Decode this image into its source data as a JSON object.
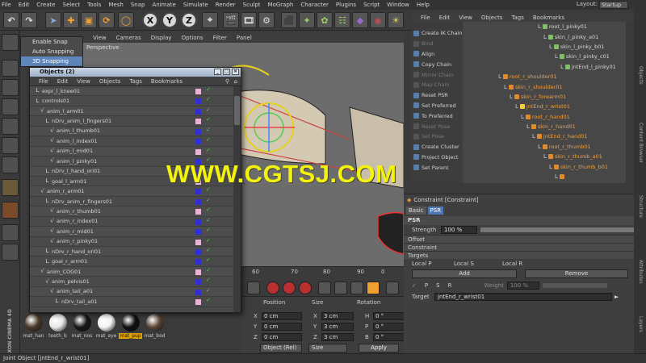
{
  "menubar": {
    "items": [
      "File",
      "Edit",
      "Create",
      "Select",
      "Tools",
      "Mesh",
      "Snap",
      "Animate",
      "Simulate",
      "Render",
      "Sculpt",
      "MoGraph",
      "Character",
      "Plugins",
      "Script",
      "Window",
      "Help"
    ],
    "layout_label": "Layout:",
    "layout_value": "Startup"
  },
  "toolbar": {
    "buttons": [
      "undo-icon",
      "redo-icon",
      "live-select-icon",
      "move-icon",
      "scale-icon",
      "rotate-icon",
      "recent-icon"
    ],
    "axis_x": "X",
    "axis_y": "Y",
    "axis_z": "Z"
  },
  "snap_menu": {
    "items": [
      "Enable Snap",
      "Auto Snapping",
      "3D Snapping"
    ],
    "selected_index": 2
  },
  "viewport": {
    "menu": [
      "View",
      "Cameras",
      "Display",
      "Options",
      "Filter",
      "Panel"
    ],
    "label": "Perspective"
  },
  "objects_window": {
    "title": "Objects (2)",
    "menu": [
      "File",
      "Edit",
      "View",
      "Objects",
      "Tags",
      "Bookmarks"
    ],
    "rows": [
      {
        "name": "expr_l_knee01",
        "indent": 0
      },
      {
        "name": "controls01",
        "indent": 0
      },
      {
        "name": "anim_l_arm01",
        "indent": 1
      },
      {
        "name": "nDrv_anim_l_fingers01",
        "indent": 2
      },
      {
        "name": "anim_l_thumb01",
        "indent": 3
      },
      {
        "name": "anim_l_index01",
        "indent": 3
      },
      {
        "name": "anim_l_mid01",
        "indent": 3
      },
      {
        "name": "anim_l_pinky01",
        "indent": 3
      },
      {
        "name": "nDrv_l_hand_ori01",
        "indent": 2
      },
      {
        "name": "goal_l_arm01",
        "indent": 2
      },
      {
        "name": "anim_r_arm01",
        "indent": 1
      },
      {
        "name": "nDrv_anim_r_fingers01",
        "indent": 2
      },
      {
        "name": "anim_r_thumb01",
        "indent": 3
      },
      {
        "name": "anim_r_index01",
        "indent": 3
      },
      {
        "name": "anim_r_mid01",
        "indent": 3
      },
      {
        "name": "anim_r_pinky01",
        "indent": 3
      },
      {
        "name": "nDrv_r_hand_ori01",
        "indent": 2
      },
      {
        "name": "goal_r_arm01",
        "indent": 2
      },
      {
        "name": "anim_COG01",
        "indent": 1
      },
      {
        "name": "anim_pelvis01",
        "indent": 2
      },
      {
        "name": "anim_tail_a01",
        "indent": 3
      },
      {
        "name": "nDrv_tail_a01",
        "indent": 4
      }
    ]
  },
  "command_panel": {
    "items": [
      {
        "label": "Create IK Chain",
        "enabled": true
      },
      {
        "label": "Bind",
        "enabled": false
      },
      {
        "label": "Align",
        "enabled": true
      },
      {
        "label": "Copy Chain",
        "enabled": true
      },
      {
        "label": "Mirror Chain",
        "enabled": false
      },
      {
        "label": "Map Chain",
        "enabled": false
      },
      {
        "label": "Reset PSR",
        "enabled": true
      },
      {
        "label": "Set Preferred",
        "enabled": true
      },
      {
        "label": "To Preferred",
        "enabled": true
      },
      {
        "label": "Reset Pose",
        "enabled": false
      },
      {
        "label": "Set Pose",
        "enabled": false
      },
      {
        "label": "Create Cluster",
        "enabled": true
      },
      {
        "label": "Project Object",
        "enabled": true
      },
      {
        "label": "Set Parent",
        "enabled": true
      }
    ]
  },
  "object_manager": {
    "menu": [
      "File",
      "Edit",
      "View",
      "Objects",
      "Tags",
      "Bookmarks"
    ],
    "rows": [
      {
        "name": "root_l_pinky01",
        "indent": 7,
        "color": "#7fbf6a",
        "selected": false
      },
      {
        "name": "skin_l_pinky_a01",
        "indent": 8,
        "color": "#7fbf6a",
        "selected": false
      },
      {
        "name": "skin_l_pinky_b01",
        "indent": 9,
        "color": "#7fbf6a",
        "selected": false
      },
      {
        "name": "skin_l_pinky_c01",
        "indent": 10,
        "color": "#7fbf6a",
        "selected": false
      },
      {
        "name": "jntEnd_l_pinky01",
        "indent": 11,
        "color": "#7fbf6a",
        "selected": false
      },
      {
        "name": "root_r_shoulder01",
        "indent": 0,
        "color": "#e08a2a",
        "selected": true
      },
      {
        "name": "skin_r_shoulder01",
        "indent": 1,
        "color": "#e08a2a",
        "selected": true
      },
      {
        "name": "skin_r_forearm01",
        "indent": 2,
        "color": "#e08a2a",
        "selected": true
      },
      {
        "name": "jntEnd_r_wrist01",
        "indent": 3,
        "color": "#f0d040",
        "selected": true
      },
      {
        "name": "root_r_hand01",
        "indent": 4,
        "color": "#e08a2a",
        "selected": true
      },
      {
        "name": "skin_r_hand01",
        "indent": 5,
        "color": "#e08a2a",
        "selected": true
      },
      {
        "name": "jntEnd_r_hand01",
        "indent": 6,
        "color": "#e08a2a",
        "selected": true
      },
      {
        "name": "root_r_thumb01",
        "indent": 7,
        "color": "#e08a2a",
        "selected": true
      },
      {
        "name": "skin_r_thumb_a01",
        "indent": 8,
        "color": "#e08a2a",
        "selected": true
      },
      {
        "name": "skin_r_thumb_b01",
        "indent": 9,
        "color": "#e08a2a",
        "selected": true
      },
      {
        "name": "",
        "indent": 10,
        "color": "#e08a2a",
        "selected": true
      }
    ]
  },
  "side_tabs": [
    "Objects",
    "Content Browser",
    "Structure",
    "Attributes",
    "Layers"
  ],
  "attributes": {
    "header": "Constraint [Constraint]",
    "tabs": [
      "Basic",
      "PSR"
    ],
    "selected_tab": 1,
    "section": "PSR",
    "strength_label": "Strength",
    "strength_value": "100 %",
    "strength_fraction": 1.0,
    "groups": [
      "Offset",
      "Constraint",
      "Targets"
    ],
    "radio_labels": [
      "Local P",
      "Local S",
      "Local R"
    ],
    "add_label": "Add",
    "remove_label": "Remove",
    "target_letter_p": "P",
    "target_letter_s": "S",
    "target_letter_r": "R",
    "weight_label": "Weight",
    "weight_value": "100 %",
    "target_label": "Target",
    "target_value": "jntEnd_r_wrist01"
  },
  "timeline": {
    "ticks": [
      "60",
      "70",
      "80",
      "90"
    ],
    "frame_label": "0"
  },
  "coordinates": {
    "headers": [
      "Position",
      "Size",
      "Rotation"
    ],
    "rows": [
      {
        "axis": "X",
        "pos": "0 cm",
        "size_axis": "X",
        "size": "3 cm",
        "rot_axis": "H",
        "rot": "0 °"
      },
      {
        "axis": "Y",
        "pos": "0 cm",
        "size_axis": "Y",
        "size": "3 cm",
        "rot_axis": "P",
        "rot": "0 °"
      },
      {
        "axis": "Z",
        "pos": "0 cm",
        "size_axis": "Z",
        "size": "3 cm",
        "rot_axis": "B",
        "rot": "0 °"
      }
    ],
    "mode_select": "Object (Rel)",
    "size_select": "Size",
    "apply_label": "Apply"
  },
  "materials": [
    {
      "name": "mat_han",
      "color": "#4a3a2a",
      "selected": false
    },
    {
      "name": "teeth_b",
      "color": "#e8e8e8",
      "selected": false
    },
    {
      "name": "mat_nos",
      "color": "#161616",
      "selected": false
    },
    {
      "name": "mat_eye",
      "color": "#f4f4f4",
      "selected": false
    },
    {
      "name": "mat_pup",
      "color": "#0e0e0e",
      "selected": true
    },
    {
      "name": "mat_bod",
      "color": "#5a4636",
      "selected": false
    }
  ],
  "brand": "MAXON CINEMA 4D",
  "status": "Joint Object [jntEnd_r_wrist01]",
  "watermark": "WWW.CGTSJ.COM",
  "colors": {
    "accent_blue": "#4f78b0",
    "selection_orange": "#e08a2a",
    "watermark_yellow": "#f2f20a"
  }
}
